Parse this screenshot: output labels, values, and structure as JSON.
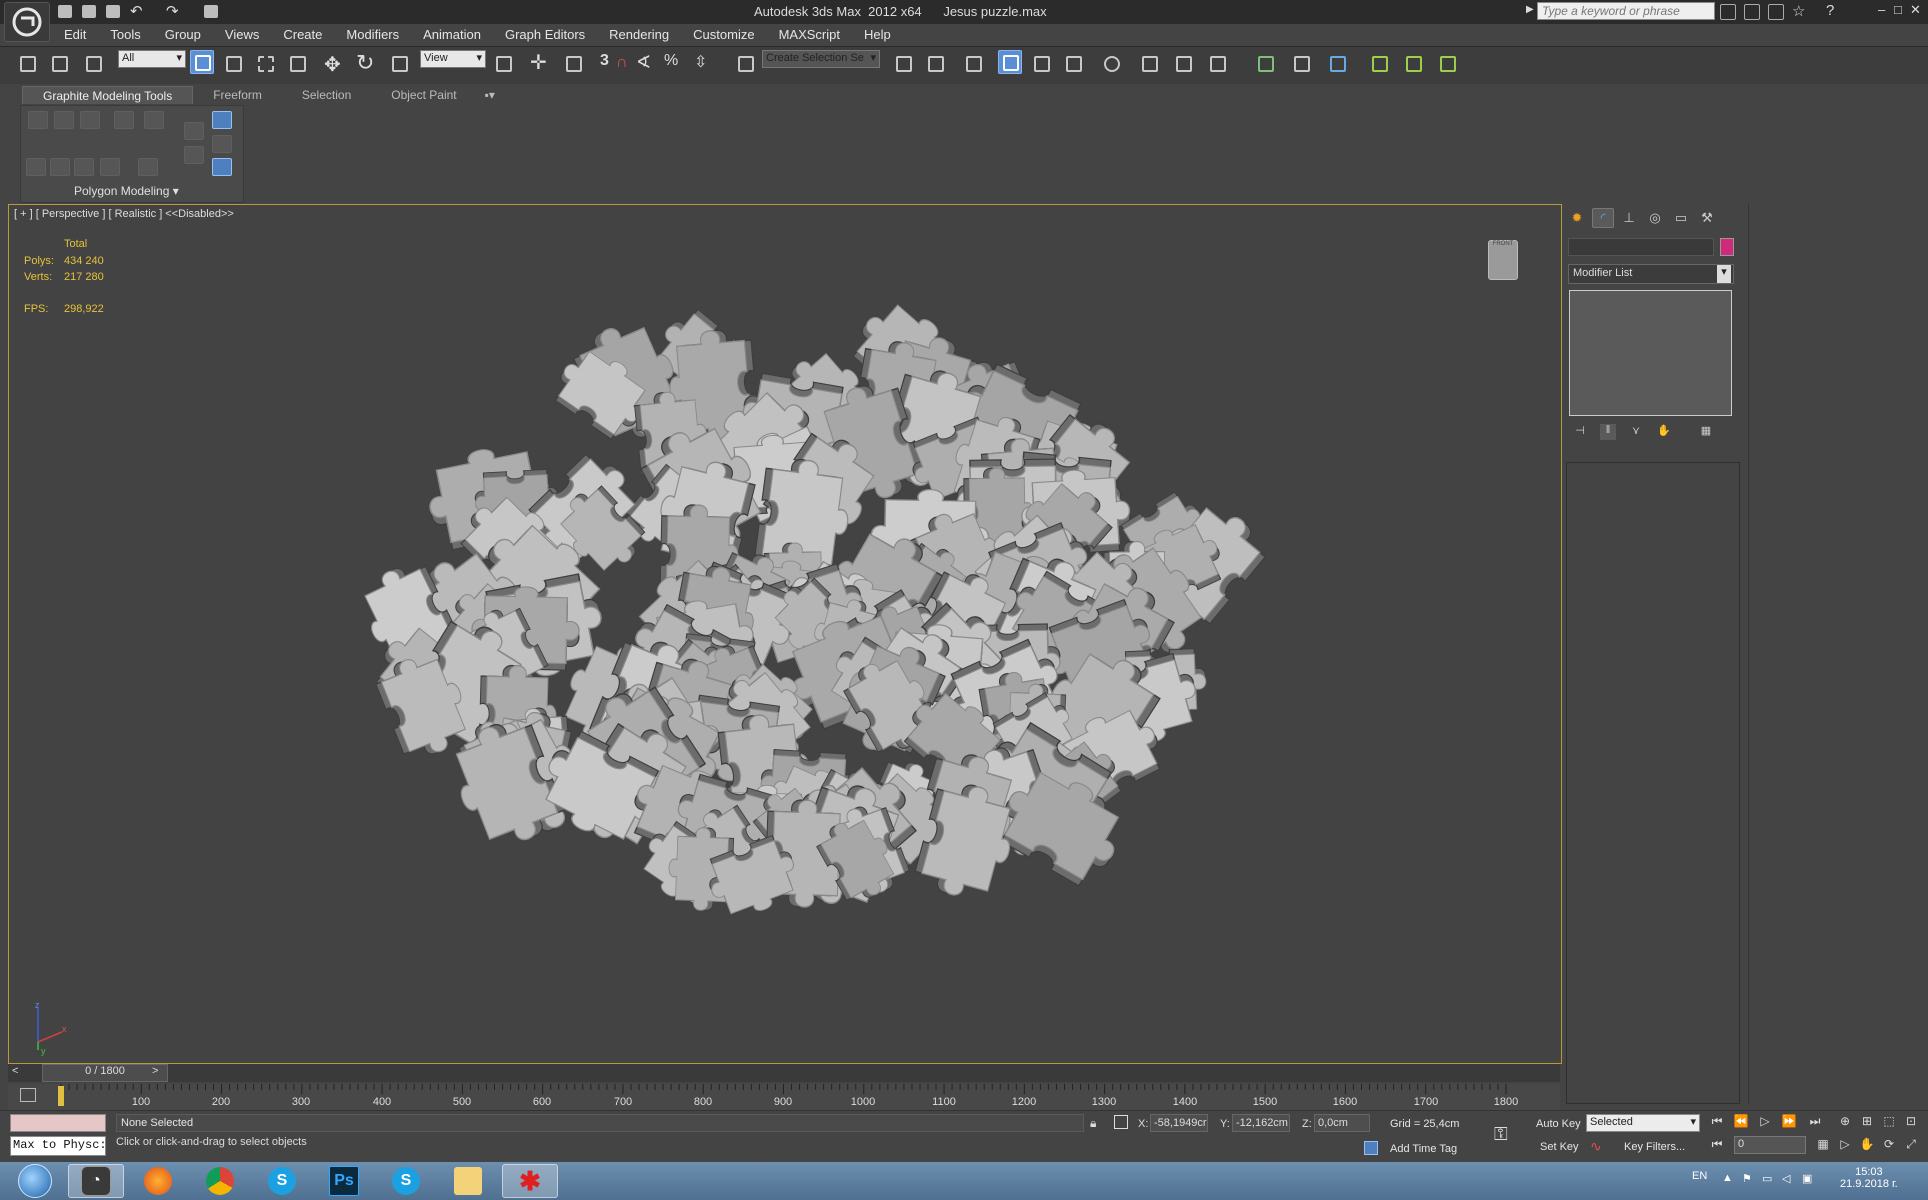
{
  "window": {
    "title": "Autodesk 3ds Max  2012 x64      Jesus puzzle.max",
    "search_placeholder": "Type a keyword or phrase",
    "minimize": "–",
    "restore": "□",
    "close": "✕"
  },
  "menu": [
    "Edit",
    "Tools",
    "Group",
    "Views",
    "Create",
    "Modifiers",
    "Animation",
    "Graph Editors",
    "Rendering",
    "Customize",
    "MAXScript",
    "Help"
  ],
  "toolbar": {
    "filter_value": "All",
    "ref_coord_value": "View",
    "named_selection_placeholder": "Create Selection Se",
    "snap_3": "3"
  },
  "ribbon": {
    "tabs": [
      "Graphite Modeling Tools",
      "Freeform",
      "Selection",
      "Object Paint"
    ],
    "active_tab": "Graphite Modeling Tools",
    "panel_label": "Polygon Modeling"
  },
  "viewport": {
    "label": "[ + ] [ Perspective ] [ Realistic ] <<Disabled>>",
    "stats": {
      "header": "Total",
      "polys_label": "Polys:",
      "polys_value": "434 240",
      "verts_label": "Verts:",
      "verts_value": "217 280",
      "fps_label": "FPS:",
      "fps_value": "298,922"
    },
    "viewcube_label": "FRONT",
    "axis_labels": [
      "z",
      "x",
      "y"
    ]
  },
  "command_panel": {
    "tabs": [
      "create-icon",
      "modify-icon",
      "hierarchy-icon",
      "motion-icon",
      "display-icon",
      "utilities-icon"
    ],
    "modifier_list": "Modifier List",
    "object_color": "#d02a7c"
  },
  "timeline": {
    "slider_label": "0 / 1800",
    "prev": "<",
    "next": ">",
    "ticks": [
      "100",
      "200",
      "300",
      "400",
      "500",
      "600",
      "700",
      "800",
      "900",
      "1000",
      "1100",
      "1200",
      "1300",
      "1400",
      "1500",
      "1600",
      "1700",
      "1800"
    ]
  },
  "status": {
    "maxscript_text": "Max to Physc:",
    "selection": "None Selected",
    "prompt": "Click or click-and-drag to select objects",
    "x_label": "X:",
    "x_value": "-58,1949cr",
    "y_label": "Y:",
    "y_value": "-12,162cm",
    "z_label": "Z:",
    "z_value": "0,0cm",
    "grid": "Grid = 25,4cm",
    "add_time_tag": "Add Time Tag",
    "auto_key": "Auto Key",
    "set_key": "Set Key",
    "key_mode": "Selected",
    "key_filters": "Key Filters...",
    "current_frame": "0"
  },
  "taskbar": {
    "apps": [
      "start-icon",
      "3dsmax-icon",
      "firefox-icon",
      "chrome-icon",
      "skype-icon",
      "photoshop-icon",
      "skype-icon",
      "explorer-icon",
      "app-icon"
    ],
    "ps_text": "Ps",
    "language": "EN",
    "time": "15:03",
    "date": "21.9.2018 г."
  }
}
